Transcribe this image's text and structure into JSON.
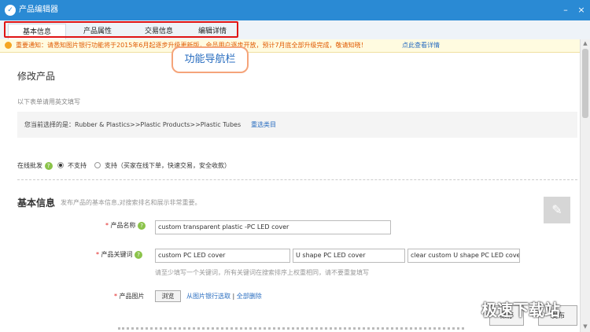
{
  "window": {
    "title": "产品编辑器",
    "minimize": "–",
    "close": "×"
  },
  "tabs": [
    {
      "label": "基本信息",
      "active": true
    },
    {
      "label": "产品属性",
      "active": false
    },
    {
      "label": "交易信息",
      "active": false
    },
    {
      "label": "编辑详情",
      "active": false
    }
  ],
  "notice": {
    "text": "重要通知：请悉知图片银行功能将于2015年6月起逐步升级更新版，会员用户逐步开放，预计7月底全部升级完成，敬请知晓！",
    "link": "点此查看详情"
  },
  "callout": "功能导航栏",
  "page": {
    "heading": "修改产品",
    "hint": "以下表单请用英文填写",
    "category_prefix": "您当前选择的是：",
    "category": "Rubber & Plastics>>Plastic Products>>Plastic Tubes",
    "reselect": "重选类目"
  },
  "wholesale": {
    "label": "在线批发",
    "opt_no": "不支持",
    "opt_yes": "支持（买家在线下单，快速交易，安全收款）",
    "selected": "不支持"
  },
  "basic": {
    "title": "基本信息",
    "desc": "发布产品的基本信息,对搜索排名和展示非常重要。",
    "name_label": "产品名称",
    "name_value": "custom transparent plastic -PC LED cover",
    "keyword_label": "产品关键词",
    "keywords": [
      "custom PC LED cover",
      "U shape PC LED cover",
      "clear custom U shape PC LED cove"
    ],
    "keyword_hint": "请至少填写一个关键词，所有关键词在搜索排序上权重相同，请不要重复填写",
    "image_label": "产品图片",
    "browse": "浏览",
    "from_bank": "从图片银行选取",
    "sep": "|",
    "delete_all": "全部删除",
    "required_mark": "*",
    "help_mark": "?"
  },
  "footer": {
    "save": "保存",
    "publish": "发布"
  },
  "watermark": "极速下载站"
}
